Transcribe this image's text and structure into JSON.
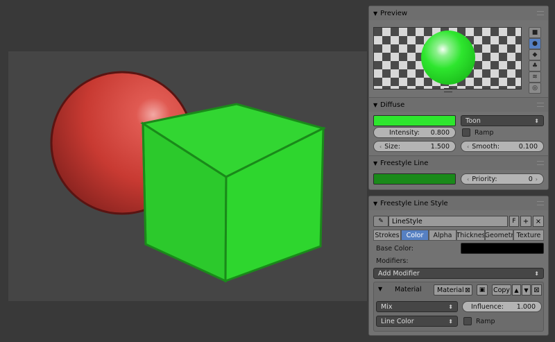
{
  "preview": {
    "title": "Preview",
    "buttons": [
      "flat-icon",
      "sphere-icon",
      "cube-icon",
      "monkey-icon",
      "hair-icon",
      "sphere-a-icon"
    ]
  },
  "diffuse": {
    "title": "Diffuse",
    "color": "#2ee62e",
    "shader": "Toon",
    "intensity_label": "Intensity:",
    "intensity_value": "0.800",
    "ramp_label": "Ramp",
    "size_label": "Size:",
    "size_value": "1.500",
    "smooth_label": "Smooth:",
    "smooth_value": "0.100"
  },
  "freestyle_line": {
    "title": "Freestyle Line",
    "color": "#1a8a1a",
    "priority_label": "Priority:",
    "priority_value": "0"
  },
  "linestyle": {
    "title": "Freestyle Line Style",
    "name": "LineStyle",
    "fake_user": "F",
    "tabs": [
      "Strokes",
      "Color",
      "Alpha",
      "Thicknes",
      "Geometr",
      "Texture"
    ],
    "active_tab": "Color",
    "base_color_label": "Base Color:",
    "base_color": "#000000",
    "modifiers_label": "Modifiers:",
    "add_modifier": "Add Modifier",
    "modifier": {
      "type_label": "Material",
      "material_btn": "Material",
      "copy_label": "Copy",
      "blend": "Mix",
      "influence_label": "Influence:",
      "influence_value": "1.000",
      "source": "Line Color",
      "ramp_label": "Ramp"
    }
  },
  "scene": {
    "sphere_color": "#c83a32",
    "cube_color": "#2ecc2e",
    "outline_color": "#7a1a18",
    "cube_outline": "#1a8a1a"
  }
}
